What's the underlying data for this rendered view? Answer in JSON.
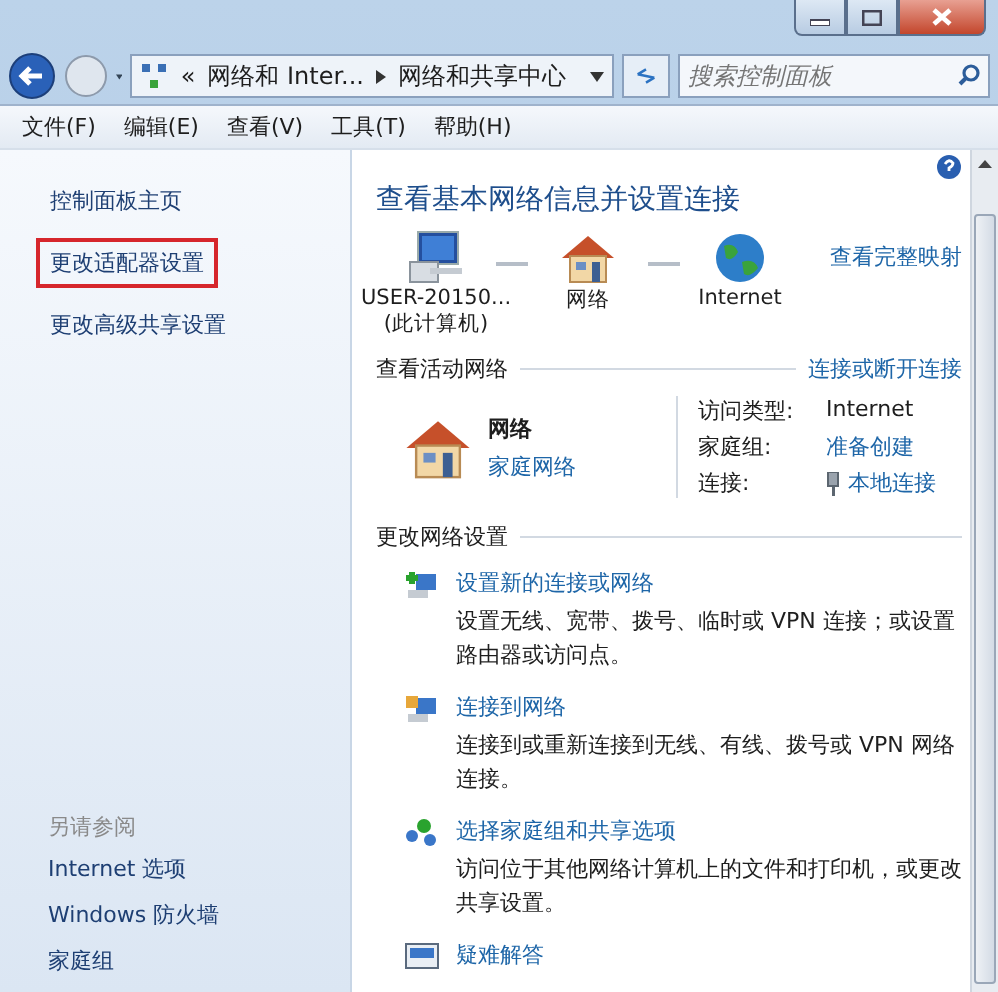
{
  "address_bar": {
    "overflow_mark": "«",
    "segments": [
      "网络和 Inter...",
      "网络和共享中心"
    ]
  },
  "search": {
    "placeholder": "搜索控制面板"
  },
  "menu": [
    "文件(F)",
    "编辑(E)",
    "查看(V)",
    "工具(T)",
    "帮助(H)"
  ],
  "sidebar": {
    "items": [
      {
        "label": "控制面板主页",
        "highlighted": false
      },
      {
        "label": "更改适配器设置",
        "highlighted": true
      },
      {
        "label": "更改高级共享设置",
        "highlighted": false
      }
    ],
    "see_also": {
      "heading": "另请参阅",
      "items": [
        "Internet 选项",
        "Windows 防火墙",
        "家庭组"
      ]
    }
  },
  "main": {
    "title": "查看基本网络信息并设置连接",
    "map_link": "查看完整映射",
    "map_nodes": [
      {
        "kind": "computer",
        "label": "USER-20150...",
        "sublabel": "(此计算机)"
      },
      {
        "kind": "house",
        "label": "网络"
      },
      {
        "kind": "globe",
        "label": "Internet"
      }
    ],
    "active": {
      "heading": "查看活动网络",
      "link": "连接或断开连接",
      "network": {
        "name": "网络",
        "type": "家庭网络"
      },
      "details": [
        {
          "kind": "text",
          "label": "访问类型:",
          "value": "Internet"
        },
        {
          "kind": "link",
          "label": "家庭组:",
          "value": "准备创建"
        },
        {
          "kind": "adapter",
          "label": "连接:",
          "value": "本地连接"
        }
      ]
    },
    "settings": {
      "heading": "更改网络设置",
      "tasks": [
        {
          "kind": "new",
          "title": "设置新的连接或网络",
          "description": "设置无线、宽带、拨号、临时或 VPN 连接；或设置路由器或访问点。"
        },
        {
          "kind": "connect",
          "title": "连接到网络",
          "description": "连接到或重新连接到无线、有线、拨号或 VPN 网络连接。"
        },
        {
          "kind": "homegroup",
          "title": "选择家庭组和共享选项",
          "description": "访问位于其他网络计算机上的文件和打印机，或更改共享设置。"
        },
        {
          "kind": "troubleshoot",
          "title": "疑难解答"
        }
      ]
    }
  }
}
